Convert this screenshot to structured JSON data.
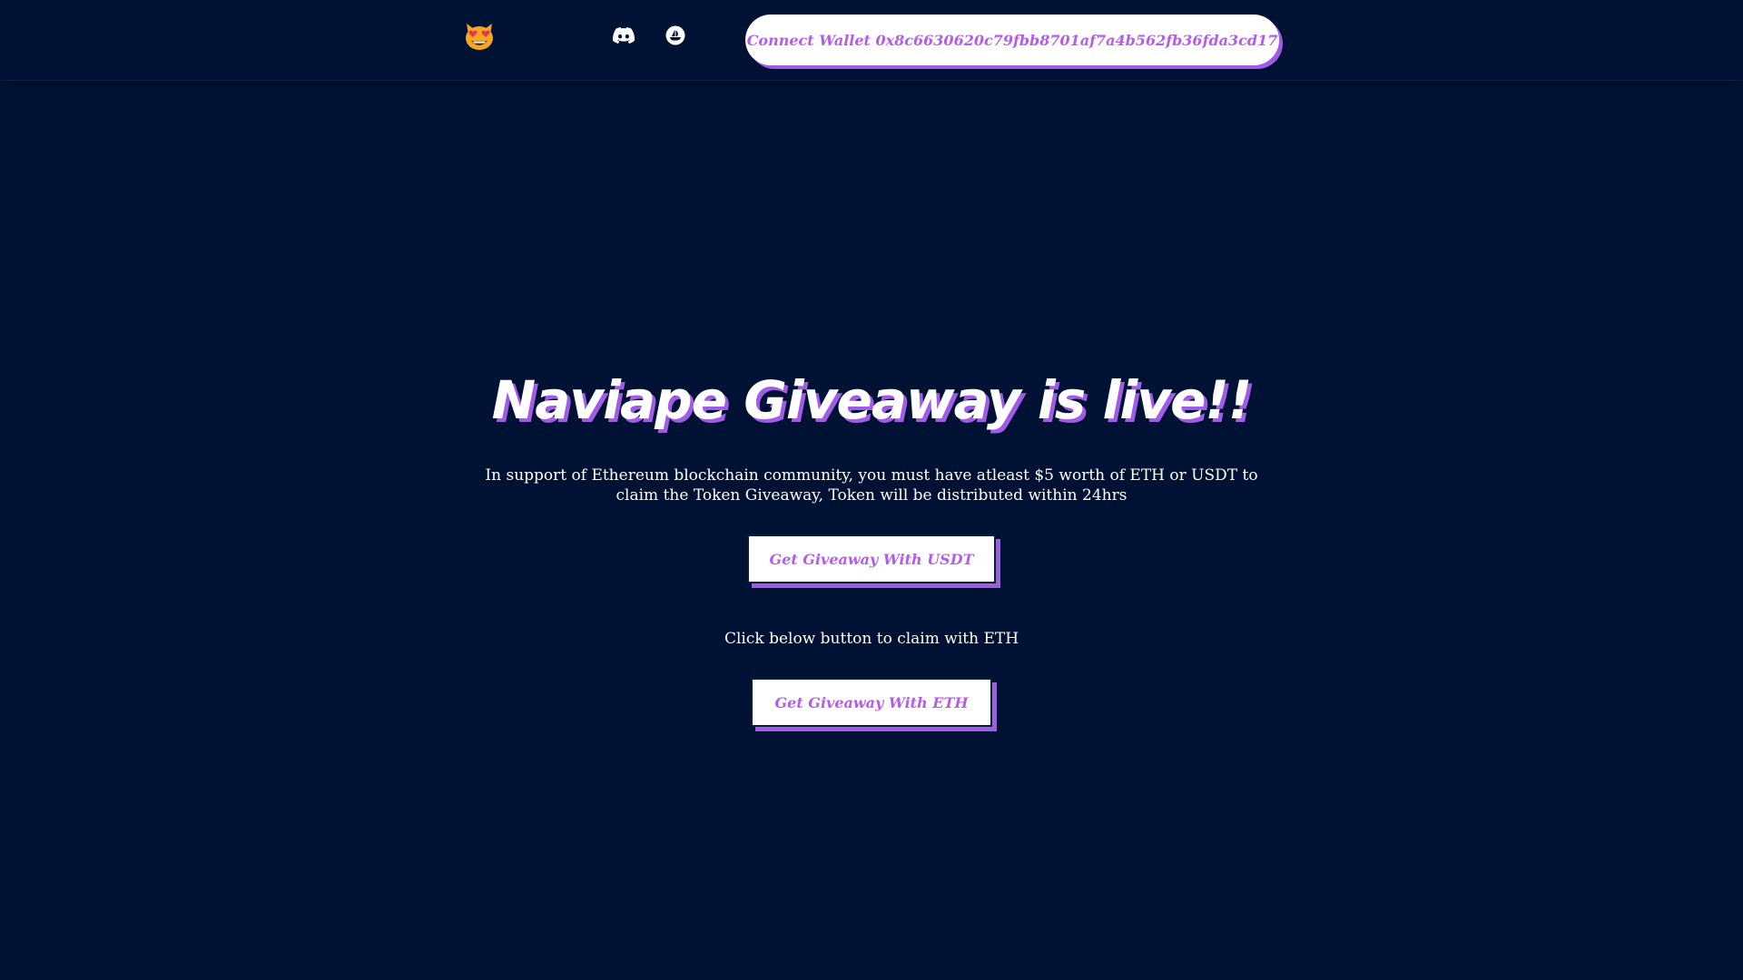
{
  "header": {
    "logo_icon": "heart-eyes-cat-emoji-icon",
    "social_links": [
      {
        "icon": "discord-icon"
      },
      {
        "icon": "opensea-icon"
      }
    ],
    "connect_wallet_label": "Connect Wallet 0x8c6630620c79fbb8701af7a4b562fb36fda3cd17"
  },
  "hero": {
    "title": "Naviape Giveaway is live!!",
    "description": "In support of Ethereum blockchain community, you must have atleast $5 worth of ETH or USDT to claim the Token Giveaway, Token will be distributed within 24hrs",
    "usdt_button_label": "Get Giveaway With USDT",
    "eth_note": "Click below button to claim with ETH",
    "eth_button_label": "Get Giveaway With ETH"
  },
  "colors": {
    "background": "#001233",
    "accent_purple": "#a15ce6",
    "button_text": "#b35ee8",
    "button_bg": "#ffffff",
    "logo_orange": "#f5a623",
    "logo_heart": "#e8334a"
  }
}
